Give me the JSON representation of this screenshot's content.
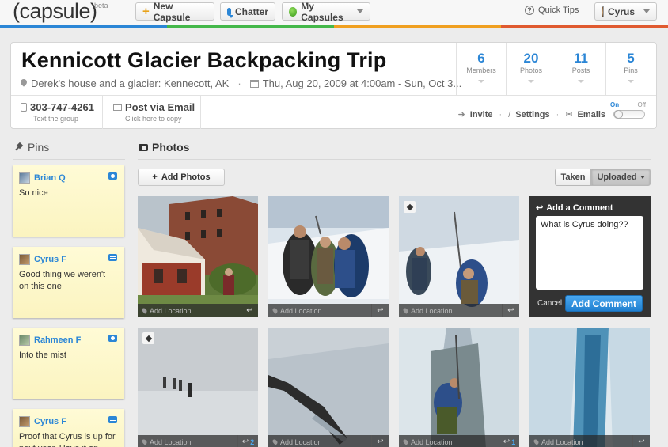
{
  "topbar": {
    "logo": "(capsule)",
    "logo_badge": "beta",
    "new_capsule": "New Capsule",
    "chatter": "Chatter",
    "my_capsules": "My Capsules",
    "quick_tips": "Quick Tips",
    "user_name": "Cyrus",
    "strip_colors": [
      "#2b86d6",
      "#44b84a",
      "#f0a020",
      "#e05a30"
    ]
  },
  "capsule": {
    "title": "Kennicott Glacier Backpacking Trip",
    "location": "Derek's house and a glacier: Kennecott, AK",
    "dates": "Thu, Aug 20, 2009 at 4:00am - Sun, Oct 3...",
    "stats": [
      {
        "num": "6",
        "label": "Members"
      },
      {
        "num": "20",
        "label": "Photos"
      },
      {
        "num": "11",
        "label": "Posts"
      },
      {
        "num": "5",
        "label": "Pins"
      }
    ],
    "phone": "303-747-4261",
    "phone_sub": "Text the group",
    "email_title": "Post via Email",
    "email_sub": "Click here to copy",
    "actions": {
      "invite": "Invite",
      "settings": "Settings",
      "emails": "Emails"
    },
    "toggle": {
      "on": "On",
      "off": "Off"
    }
  },
  "pins": {
    "heading": "Pins",
    "items": [
      {
        "user": "Brian Q",
        "text": "So nice",
        "type": "camera-icon"
      },
      {
        "user": "Cyrus F",
        "text": "Good thing we weren't on this one",
        "type": "comment-icon"
      },
      {
        "user": "Rahmeen F",
        "text": "Into the mist",
        "type": "camera-icon"
      },
      {
        "user": "Cyrus F",
        "text": "Proof that Cyrus is up for next year. Have it on",
        "type": "comment-icon"
      }
    ]
  },
  "photos": {
    "heading": "Photos",
    "add_button": "Add Photos",
    "sort": {
      "taken": "Taken",
      "uploaded": "Uploaded"
    },
    "location_label": "Add Location",
    "items": [
      {
        "scene": "buildings",
        "pinned": false,
        "replies": ""
      },
      {
        "scene": "hikers-three",
        "pinned": false,
        "replies": ""
      },
      {
        "scene": "hikers-two",
        "pinned": true,
        "replies": ""
      },
      {
        "scene": "mist",
        "pinned": true,
        "replies": "2"
      },
      {
        "scene": "ice-axe",
        "pinned": false,
        "replies": ""
      },
      {
        "scene": "climber",
        "pinned": false,
        "replies": "1"
      },
      {
        "scene": "crevasse",
        "pinned": false,
        "replies": ""
      }
    ],
    "comment": {
      "title": "Add a Comment",
      "value": "What is Cyrus doing??",
      "cancel": "Cancel",
      "submit": "Add Comment"
    }
  }
}
